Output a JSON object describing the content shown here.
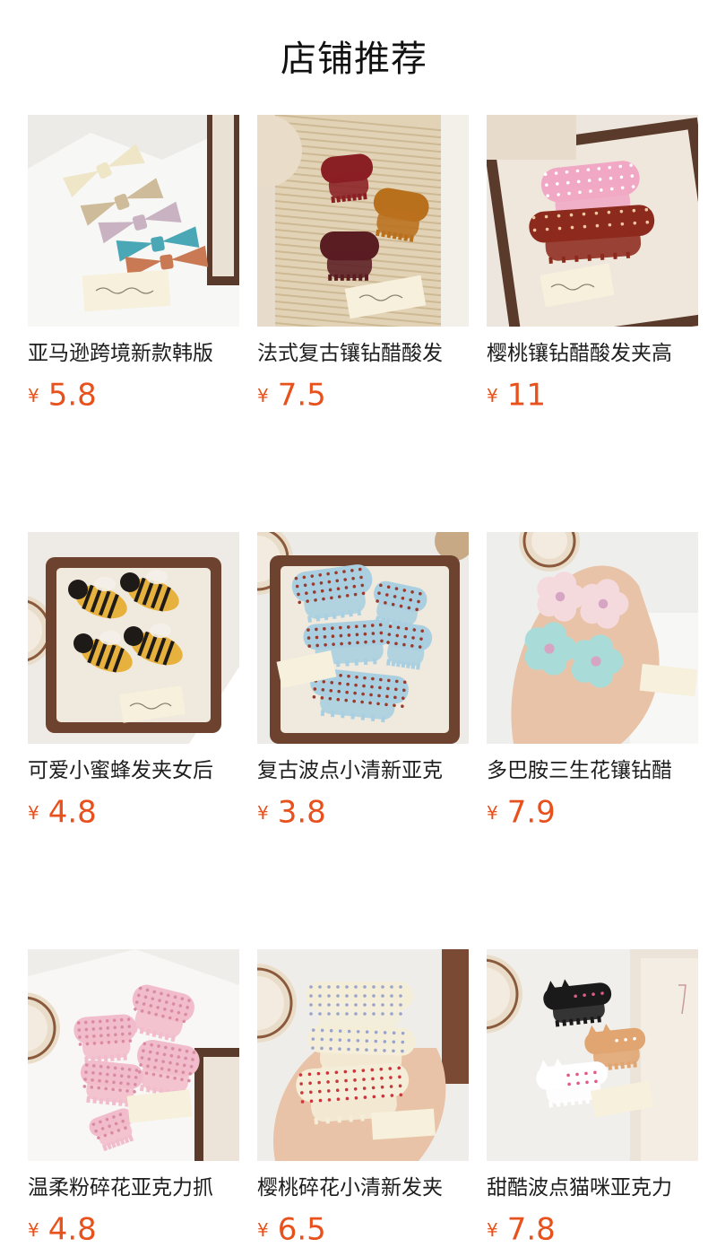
{
  "header": {
    "title": "店铺推荐"
  },
  "products": [
    {
      "name": "亚马逊跨境新款韩版",
      "currency": "¥",
      "price": "5.8",
      "image": {
        "scene": "bows",
        "bg": "#ecebe8",
        "colors": [
          "#efe6c8",
          "#cdbb9a",
          "#c9b3c2",
          "#4aa7b5",
          "#c97a54"
        ]
      }
    },
    {
      "name": "法式复古镶钻醋酸发",
      "currency": "¥",
      "price": "7.5",
      "image": {
        "scene": "claws3",
        "bg": "#e7dccb",
        "colors": [
          "#8a1f24",
          "#b9701c",
          "#5a1d22"
        ]
      }
    },
    {
      "name": "樱桃镶钻醋酸发夹高",
      "currency": "¥",
      "price": "11",
      "image": {
        "scene": "claws2",
        "bg": "#ede6df",
        "colors": [
          "#f0a8c4",
          "#8d2a1e"
        ]
      }
    },
    {
      "name": "可爱小蜜蜂发夹女后",
      "currency": "¥",
      "price": "4.8",
      "image": {
        "scene": "bees",
        "bg": "#eeebe6",
        "colors": [
          "#e6b13c",
          "#1e1a17"
        ]
      }
    },
    {
      "name": "复古波点小清新亚克",
      "currency": "¥",
      "price": "3.8",
      "image": {
        "scene": "dots",
        "bg": "#ecebe8",
        "colors": [
          "#a9cfe0",
          "#9a3a2c"
        ]
      }
    },
    {
      "name": "多巴胺三生花镶钻醋",
      "currency": "¥",
      "price": "7.9",
      "image": {
        "scene": "flowers",
        "bg": "#eeeeec",
        "colors": [
          "#f4d9dd",
          "#a9dcd8",
          "#e9c3a7"
        ]
      }
    },
    {
      "name": "温柔粉碎花亚克力抓",
      "currency": "¥",
      "price": "4.8",
      "image": {
        "scene": "pinkclaws",
        "bg": "#efedea",
        "colors": [
          "#f1bccb",
          "#d98ba2"
        ]
      }
    },
    {
      "name": "樱桃碎花小清新发夹",
      "currency": "¥",
      "price": "6.5",
      "image": {
        "scene": "floralclaws",
        "bg": "#efedea",
        "colors": [
          "#f4eed9",
          "#c9363c",
          "#e9c3a7"
        ]
      }
    },
    {
      "name": "甜酷波点猫咪亚克力",
      "currency": "¥",
      "price": "7.8",
      "image": {
        "scene": "cats",
        "bg": "#f1efec",
        "colors": [
          "#1a1a1a",
          "#e0a571",
          "#ffffff"
        ]
      }
    }
  ]
}
